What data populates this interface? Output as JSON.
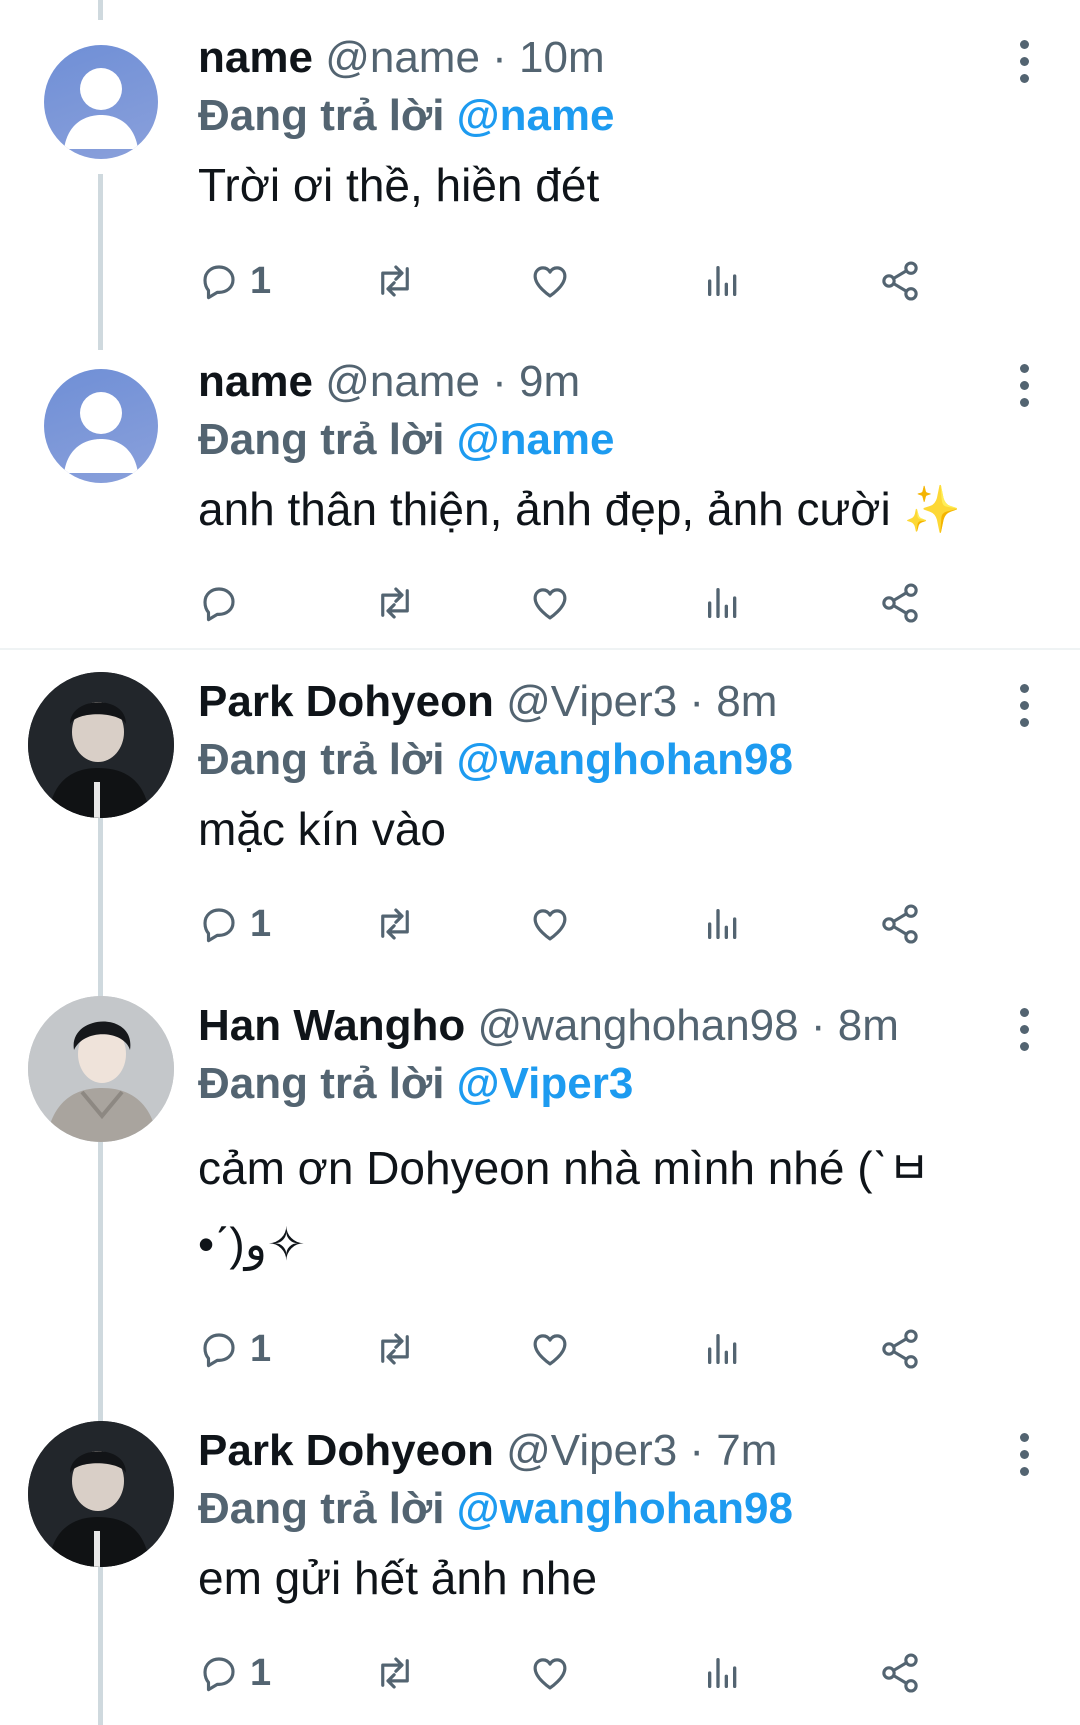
{
  "reply_prefix": "Đang trả lời",
  "tweets": [
    {
      "name": "name",
      "handle": "@name",
      "dot": "·",
      "time": "10m",
      "replying_to": "@name",
      "text": "Trời ơi thề, hiền đét",
      "reply_count": "1",
      "avatar": "default-avatar"
    },
    {
      "name": "name",
      "handle": "@name",
      "dot": "·",
      "time": "9m",
      "replying_to": "@name",
      "text": "anh thân thiện, ảnh đẹp, ảnh cười ✨",
      "reply_count": "",
      "avatar": "default-avatar"
    },
    {
      "name": "Park Dohyeon",
      "handle": "@Viper3",
      "dot": "·",
      "time": "8m",
      "replying_to": "@wanghohan98",
      "text": "mặc kín vào",
      "reply_count": "1",
      "avatar": "photo-avatar"
    },
    {
      "name": "Han Wangho",
      "handle": "@wanghohan98",
      "dot": "·",
      "time": "8m",
      "replying_to": "@Viper3",
      "text": "cảm ơn Dohyeon nhà mình nhé (ˋㅂ•ˊ)و✧",
      "reply_count": "1",
      "avatar": "photo-avatar"
    },
    {
      "name": "Park Dohyeon",
      "handle": "@Viper3",
      "dot": "·",
      "time": "7m",
      "replying_to": "@wanghohan98",
      "text": "em gửi hết ảnh nhe",
      "reply_count": "1",
      "avatar": "photo-avatar"
    }
  ],
  "colors": {
    "accent": "#1d9bf0",
    "muted": "#536471",
    "text": "#0f1419",
    "thread": "#cfd9de"
  }
}
